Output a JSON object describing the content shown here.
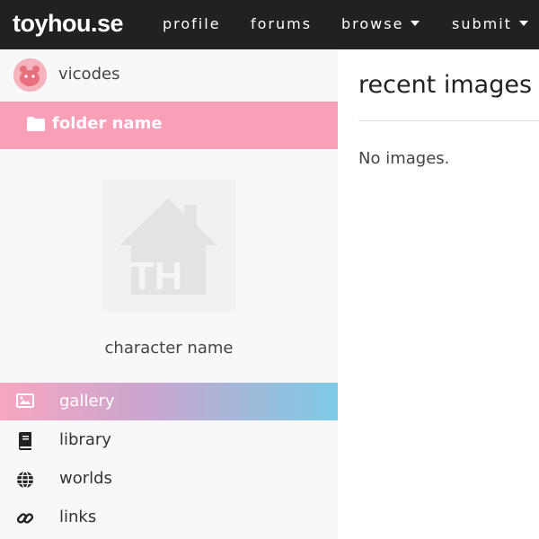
{
  "nav": {
    "brand": "toyhou.se",
    "items": [
      {
        "label": "profile",
        "has_dropdown": false
      },
      {
        "label": "forums",
        "has_dropdown": false
      },
      {
        "label": "browse",
        "has_dropdown": true
      },
      {
        "label": "submit",
        "has_dropdown": true
      }
    ]
  },
  "sidebar": {
    "username": "vicodes",
    "folder_label": "folder name",
    "character_name": "character name",
    "thumbnail_text": "TH",
    "links": [
      {
        "label": "gallery",
        "icon": "image-icon",
        "active": true
      },
      {
        "label": "library",
        "icon": "book-icon",
        "active": false
      },
      {
        "label": "worlds",
        "icon": "globe-icon",
        "active": false
      },
      {
        "label": "links",
        "icon": "link-icon",
        "active": false
      }
    ]
  },
  "main": {
    "title": "recent images",
    "empty_text": "No images."
  },
  "colors": {
    "topbar": "#212121",
    "folder_bar": "#f9a0b8",
    "active_gradient_start": "#f7a6c0",
    "active_gradient_end": "#7dcbe6",
    "sidebar_bg": "#f8f8f8"
  }
}
